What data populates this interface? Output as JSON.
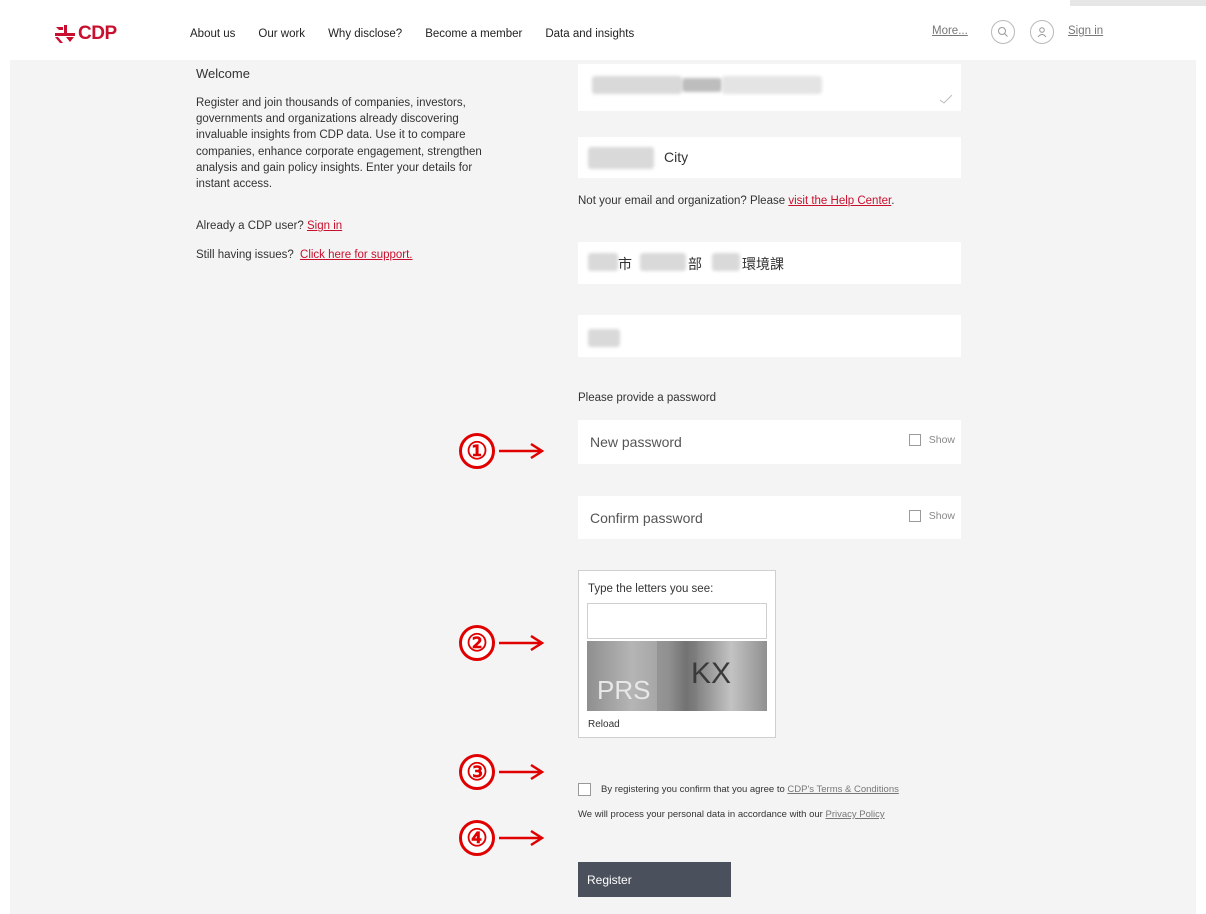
{
  "header": {
    "logo_text": "CDP",
    "nav": [
      "About us",
      "Our work",
      "Why disclose?",
      "Become a member",
      "Data and insights"
    ],
    "more": "More...",
    "sign_in": "Sign in"
  },
  "left": {
    "welcome": "Welcome",
    "intro": "Register and join thousands of companies, investors, governments and organizations already discovering invaluable insights from CDP data. Use it to compare companies, enhance corporate engagement, strengthen analysis and gain policy insights. Enter your details for instant access.",
    "already_prefix": "Already a CDP user?",
    "already_link": "Sign in",
    "issues_prefix": "Still having issues?",
    "issues_link": "Click here for support."
  },
  "form": {
    "city_value": "City",
    "help_prefix": "Not your email and organization? Please",
    "help_link": "visit the Help Center",
    "org_part1": "市",
    "org_part2": "部",
    "org_part3": "環境課",
    "password_heading": "Please provide a password",
    "new_password_placeholder": "New password",
    "confirm_password_placeholder": "Confirm password",
    "show_label": "Show",
    "captcha_label": "Type the letters you see:",
    "captcha_text_1": "PRS",
    "captcha_text_2": "KX",
    "reload": "Reload",
    "terms_prefix": "By registering you confirm that you agree to",
    "terms_link": "CDP's Terms & Conditions",
    "privacy_prefix": "We will process your personal data in accordance with our",
    "privacy_link": "Privacy Policy",
    "register_button": "Register"
  },
  "annotations": [
    "①",
    "②",
    "③",
    "④"
  ],
  "colors": {
    "brand_red": "#c8102e",
    "annotation_red": "#e00000",
    "button_dark": "#4a505c",
    "background_grey": "#f4f4f4"
  }
}
